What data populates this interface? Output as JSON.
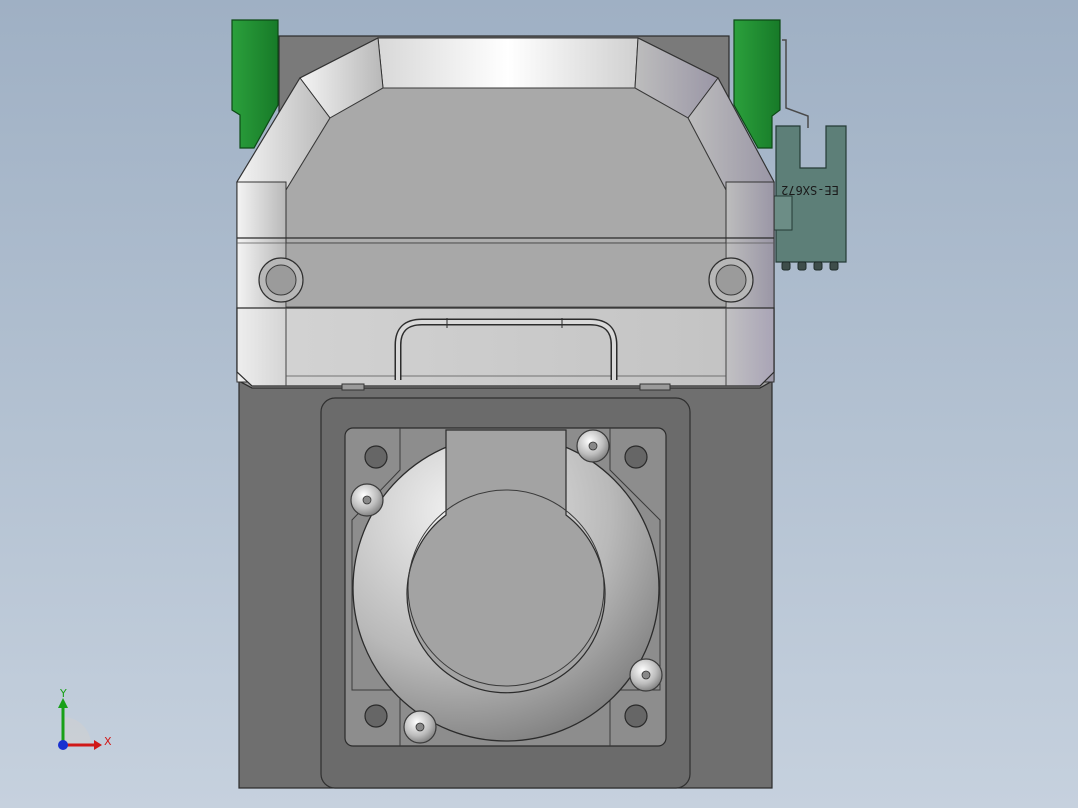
{
  "viewport": {
    "background_top": "#9fb0c4",
    "background_bottom": "#c6d1de"
  },
  "sensor": {
    "part_label": "EE-SX672"
  },
  "triad": {
    "x_label": "X",
    "y_label": "Y",
    "x_color": "#d01818",
    "y_color": "#18a018",
    "z_color": "#1830d0"
  },
  "colors": {
    "body_dark": "#6f6f6f",
    "plate": "#8d8d8d",
    "housing": "#c9c9c9",
    "green_clip": "#1f8a30",
    "sensor_body": "#5d7f78"
  }
}
